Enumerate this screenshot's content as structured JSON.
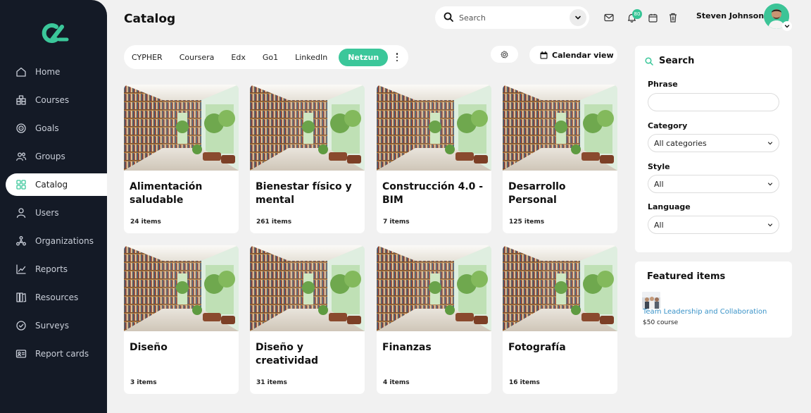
{
  "colors": {
    "accent": "#3bc79a",
    "sidebar": "#141a26",
    "link": "#3a93c8"
  },
  "sidebar": {
    "logo": "logo-mark",
    "items": [
      {
        "label": "Home",
        "icon": "home-icon"
      },
      {
        "label": "Courses",
        "icon": "courses-icon"
      },
      {
        "label": "Goals",
        "icon": "goals-icon"
      },
      {
        "label": "Groups",
        "icon": "groups-icon"
      },
      {
        "label": "Catalog",
        "icon": "catalog-icon",
        "active": true
      },
      {
        "label": "Users",
        "icon": "user-icon"
      },
      {
        "label": "Organizations",
        "icon": "organizations-icon"
      },
      {
        "label": "Reports",
        "icon": "reports-icon"
      },
      {
        "label": "Resources",
        "icon": "resources-icon"
      },
      {
        "label": "Surveys",
        "icon": "surveys-icon"
      },
      {
        "label": "Report cards",
        "icon": "report-cards-icon"
      }
    ]
  },
  "header": {
    "title": "Catalog",
    "search_placeholder": "Search",
    "notification_count": "80",
    "user_name": "Steven Johnson"
  },
  "tabs": {
    "items": [
      "CYPHER",
      "Coursera",
      "Edx",
      "Go1",
      "LinkedIn",
      "Netzun"
    ],
    "active": "Netzun"
  },
  "toolbar": {
    "calendar_label": "Calendar view"
  },
  "cards": [
    {
      "title": "Alimentación saludable",
      "count": "24 items"
    },
    {
      "title": "Bienestar físico y mental",
      "count": "261 items"
    },
    {
      "title": "Construcción 4.0 - BIM",
      "count": "7 items"
    },
    {
      "title": "Desarrollo Personal",
      "count": "125 items"
    },
    {
      "title": "Diseño",
      "count": "3 items"
    },
    {
      "title": "Diseño y creatividad",
      "count": "31 items"
    },
    {
      "title": "Finanzas",
      "count": "4 items"
    },
    {
      "title": "Fotografía",
      "count": "16 items"
    }
  ],
  "search_panel": {
    "title": "Search",
    "phrase_label": "Phrase",
    "phrase_value": "",
    "category_label": "Category",
    "category_value": "All categories",
    "style_label": "Style",
    "style_value": "All",
    "language_label": "Language",
    "language_value": "All"
  },
  "featured": {
    "title": "Featured items",
    "item_title": "Team Leadership and Collaboration",
    "item_meta": "$50 course"
  }
}
